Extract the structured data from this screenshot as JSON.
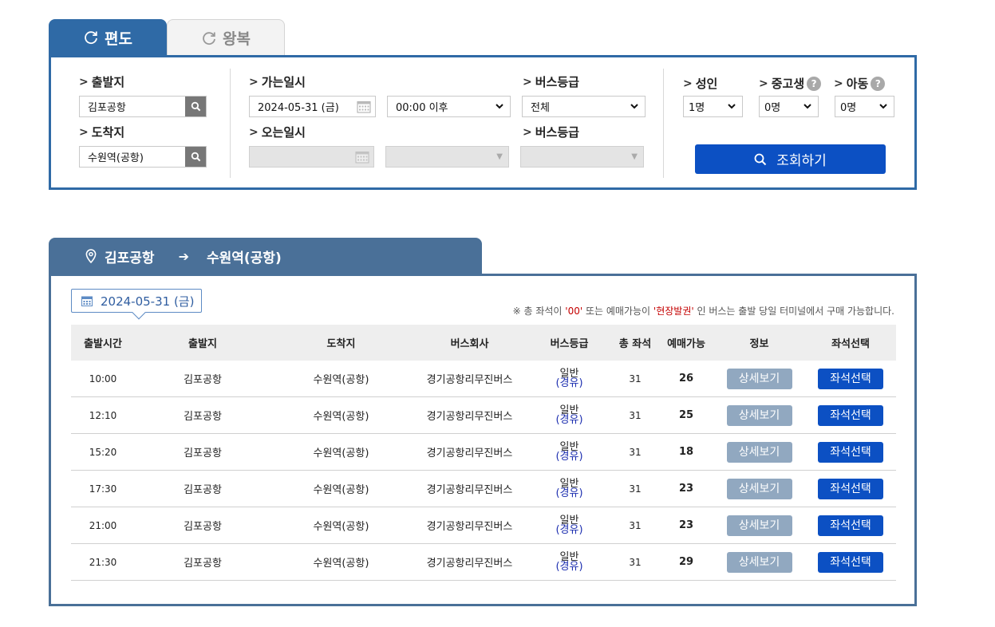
{
  "tabs": {
    "oneway": "편도",
    "roundtrip": "왕복"
  },
  "search": {
    "departure_label": "출발지",
    "departure_value": "김포공항",
    "arrival_label": "도착지",
    "arrival_value": "수원역(공항)",
    "go_date_label": "가는일시",
    "go_date_value": "2024-05-31 (금)",
    "go_time_value": "00:00 이후",
    "return_date_label": "오는일시",
    "bus_grade_label": "버스등급",
    "bus_grade_value": "전체",
    "bus_grade_label2": "버스등급",
    "adult_label": "성인",
    "adult_value": "1명",
    "youth_label": "중고생",
    "youth_value": "0명",
    "child_label": "아동",
    "child_value": "0명",
    "help_mark": "?",
    "search_button": "조회하기"
  },
  "route": {
    "from": "김포공항",
    "to": "수원역(공항)"
  },
  "results": {
    "date": "2024-05-31 (금)",
    "notice_prefix": "※ 총 좌석이 ",
    "notice_zero": "'00'",
    "notice_mid": " 또는 예매가능이 ",
    "notice_onsite": "'현장발권'",
    "notice_suffix": " 인 버스는 출발 당일 터미널에서 구매 가능합니다.",
    "headers": [
      "출발시간",
      "출발지",
      "도착지",
      "버스회사",
      "버스등급",
      "총 좌석",
      "예매가능",
      "정보",
      "좌석선택"
    ],
    "rows": [
      {
        "time": "10:00",
        "from": "김포공항",
        "to": "수원역(공항)",
        "company": "경기공항리무진버스",
        "grade": "일반",
        "via": "(경유)",
        "total": "31",
        "available": "26",
        "detail": "상세보기",
        "seat": "좌석선택"
      },
      {
        "time": "12:10",
        "from": "김포공항",
        "to": "수원역(공항)",
        "company": "경기공항리무진버스",
        "grade": "일반",
        "via": "(경유)",
        "total": "31",
        "available": "25",
        "detail": "상세보기",
        "seat": "좌석선택"
      },
      {
        "time": "15:20",
        "from": "김포공항",
        "to": "수원역(공항)",
        "company": "경기공항리무진버스",
        "grade": "일반",
        "via": "(경유)",
        "total": "31",
        "available": "18",
        "detail": "상세보기",
        "seat": "좌석선택"
      },
      {
        "time": "17:30",
        "from": "김포공항",
        "to": "수원역(공항)",
        "company": "경기공항리무진버스",
        "grade": "일반",
        "via": "(경유)",
        "total": "31",
        "available": "23",
        "detail": "상세보기",
        "seat": "좌석선택"
      },
      {
        "time": "21:00",
        "from": "김포공항",
        "to": "수원역(공항)",
        "company": "경기공항리무진버스",
        "grade": "일반",
        "via": "(경유)",
        "total": "31",
        "available": "23",
        "detail": "상세보기",
        "seat": "좌석선택"
      },
      {
        "time": "21:30",
        "from": "김포공항",
        "to": "수원역(공항)",
        "company": "경기공항리무진버스",
        "grade": "일반",
        "via": "(경유)",
        "total": "31",
        "available": "29",
        "detail": "상세보기",
        "seat": "좌석선택"
      }
    ]
  },
  "colors": {
    "primary": "#2f6aa6",
    "button": "#0c50c3",
    "route_tab": "#4a7098",
    "detail_button": "#91a8c0",
    "via_text": "#1d2fb0",
    "notice_red": "#c40000"
  }
}
